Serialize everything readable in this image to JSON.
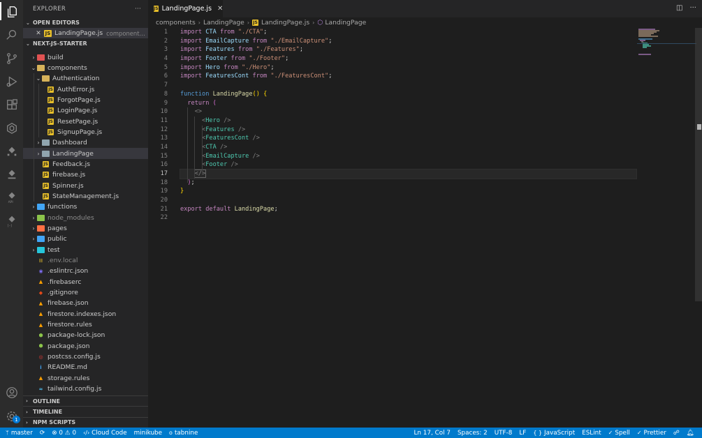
{
  "sidebar": {
    "title": "EXPLORER",
    "more": "···",
    "open_editors": {
      "label": "OPEN EDITORS",
      "file": "LandingPage.js",
      "path": "components/L..."
    },
    "project": "NEXT-JS-STARTER",
    "tree": [
      {
        "label": "build",
        "type": "folder",
        "color": "#e05252",
        "indent": 0,
        "chevron": "›"
      },
      {
        "label": "components",
        "type": "folder",
        "color": "#d6b25a",
        "indent": 0,
        "chevron": "⌄"
      },
      {
        "label": "Authentication",
        "type": "folder",
        "color": "#d6b25a",
        "indent": 1,
        "chevron": "⌄"
      },
      {
        "label": "AuthError.js",
        "type": "js",
        "indent": 2
      },
      {
        "label": "ForgotPage.js",
        "type": "js",
        "indent": 2
      },
      {
        "label": "LoginPage.js",
        "type": "js",
        "indent": 2
      },
      {
        "label": "ResetPage.js",
        "type": "js",
        "indent": 2
      },
      {
        "label": "SignupPage.js",
        "type": "js",
        "indent": 2
      },
      {
        "label": "Dashboard",
        "type": "folder",
        "color": "#90a4ae",
        "indent": 1,
        "chevron": "›"
      },
      {
        "label": "LandingPage",
        "type": "folder",
        "color": "#90a4ae",
        "indent": 1,
        "chevron": "›",
        "selected": true
      },
      {
        "label": "Feedback.js",
        "type": "js",
        "indent": 1
      },
      {
        "label": "firebase.js",
        "type": "js",
        "indent": 1
      },
      {
        "label": "Spinner.js",
        "type": "js",
        "indent": 1
      },
      {
        "label": "StateManagement.js",
        "type": "js",
        "indent": 1
      },
      {
        "label": "functions",
        "type": "folder",
        "color": "#42a5f5",
        "indent": 0,
        "chevron": "›"
      },
      {
        "label": "node_modules",
        "type": "folder",
        "color": "#8bc34a",
        "indent": 0,
        "chevron": "›",
        "dim": true
      },
      {
        "label": "pages",
        "type": "folder",
        "color": "#ff7043",
        "indent": 0,
        "chevron": "›"
      },
      {
        "label": "public",
        "type": "folder",
        "color": "#42a5f5",
        "indent": 0,
        "chevron": "›"
      },
      {
        "label": "test",
        "type": "folder",
        "color": "#26c6da",
        "indent": 0,
        "chevron": "›"
      },
      {
        "label": ".env.local",
        "type": "file",
        "glyph": "⁞⁞",
        "color": "#e8bf2a",
        "indent": 0,
        "dim": true
      },
      {
        "label": ".eslintrc.json",
        "type": "file",
        "glyph": "◉",
        "color": "#7c6cf0",
        "indent": 0
      },
      {
        "label": ".firebaserc",
        "type": "file",
        "glyph": "▲",
        "color": "#ffa000",
        "indent": 0
      },
      {
        "label": ".gitignore",
        "type": "file",
        "glyph": "◆",
        "color": "#e64a19",
        "indent": 0
      },
      {
        "label": "firebase.json",
        "type": "file",
        "glyph": "▲",
        "color": "#ffa000",
        "indent": 0
      },
      {
        "label": "firestore.indexes.json",
        "type": "file",
        "glyph": "▲",
        "color": "#ffa000",
        "indent": 0
      },
      {
        "label": "firestore.rules",
        "type": "file",
        "glyph": "▲",
        "color": "#ffa000",
        "indent": 0
      },
      {
        "label": "package-lock.json",
        "type": "file",
        "glyph": "⬢",
        "color": "#8bc34a",
        "indent": 0
      },
      {
        "label": "package.json",
        "type": "file",
        "glyph": "⬢",
        "color": "#8bc34a",
        "indent": 0
      },
      {
        "label": "postcss.config.js",
        "type": "file",
        "glyph": "◎",
        "color": "#e53935",
        "indent": 0
      },
      {
        "label": "README.md",
        "type": "file",
        "glyph": "i",
        "color": "#42a5f5",
        "indent": 0
      },
      {
        "label": "storage.rules",
        "type": "file",
        "glyph": "▲",
        "color": "#ffa000",
        "indent": 0
      },
      {
        "label": "tailwind.config.js",
        "type": "file",
        "glyph": "≈",
        "color": "#4fc3f7",
        "indent": 0
      }
    ],
    "outline": "OUTLINE",
    "timeline": "TIMELINE",
    "npm_scripts": "NPM SCRIPTS"
  },
  "tab": {
    "label": "LandingPage.js",
    "close": "✕"
  },
  "breadcrumb": [
    "components",
    "LandingPage",
    "LandingPage.js",
    "LandingPage"
  ],
  "code": {
    "line_numbers": [
      "1",
      "2",
      "3",
      "4",
      "5",
      "6",
      "7",
      "8",
      "9",
      "10",
      "11",
      "12",
      "13",
      "14",
      "15",
      "16",
      "17",
      "18",
      "19",
      "20",
      "21",
      "22"
    ],
    "current_line": 17
  },
  "statusbar": {
    "branch": "master",
    "sync": "⟳",
    "problems": "⊗ 0 ⚠ 0",
    "cloud_code": "Cloud Code",
    "minikube": "minikube",
    "tabnine": "tabnine",
    "position": "Ln 17, Col 7",
    "spaces": "Spaces: 2",
    "encoding": "UTF-8",
    "eol": "LF",
    "language": "JavaScript",
    "eslint": "ESLint",
    "spell": "Spell",
    "prettier": "Prettier"
  },
  "colors": {
    "accent": "#007acc",
    "activity_bar": "#2c2c2c",
    "sidebar": "#252526",
    "editor": "#1e1e1e"
  },
  "icons": [
    "files-icon",
    "search-icon",
    "source-control-icon",
    "run-debug-icon",
    "extensions-icon",
    "remote-explorer-icon",
    "kubernetes-icon",
    "cloud-run-icon",
    "api-icon",
    "secret-icon",
    "account-icon",
    "settings-gear-icon"
  ]
}
